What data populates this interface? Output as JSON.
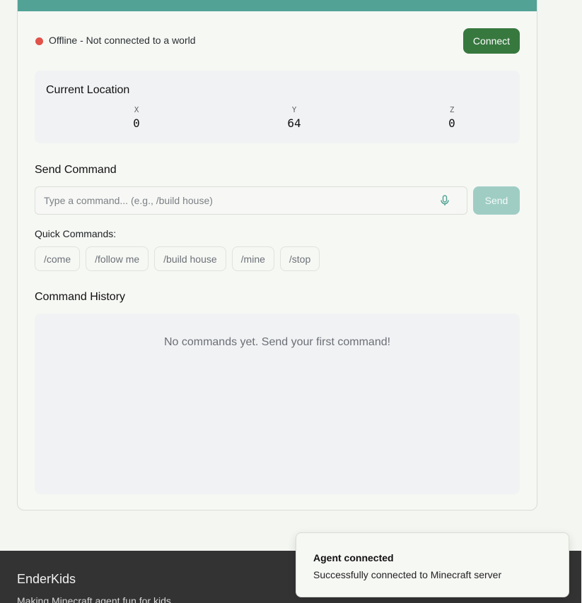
{
  "status": {
    "text": "Offline - Not connected to a world",
    "color": "#e0524a",
    "connect_label": "Connect"
  },
  "location": {
    "title": "Current Location",
    "coords": [
      {
        "label": "X",
        "value": "0"
      },
      {
        "label": "Y",
        "value": "64"
      },
      {
        "label": "Z",
        "value": "0"
      }
    ]
  },
  "command": {
    "title": "Send Command",
    "placeholder": "Type a command... (e.g., /build house)",
    "value": "",
    "mic_icon": "microphone-icon",
    "send_label": "Send"
  },
  "quick": {
    "label": "Quick Commands:",
    "items": [
      "/come",
      "/follow me",
      "/build house",
      "/mine",
      "/stop"
    ]
  },
  "history": {
    "title": "Command History",
    "empty_text": "No commands yet. Send your first command!"
  },
  "footer": {
    "brand": "EnderKids",
    "tagline": "Making Minecraft agent fun for kids"
  },
  "toast": {
    "title": "Agent connected",
    "description": "Successfully connected to Minecraft server"
  },
  "colors": {
    "accent": "#52a396",
    "connect": "#37783f",
    "send_disabled": "#9fcdc4",
    "footer_bg": "#333333"
  }
}
